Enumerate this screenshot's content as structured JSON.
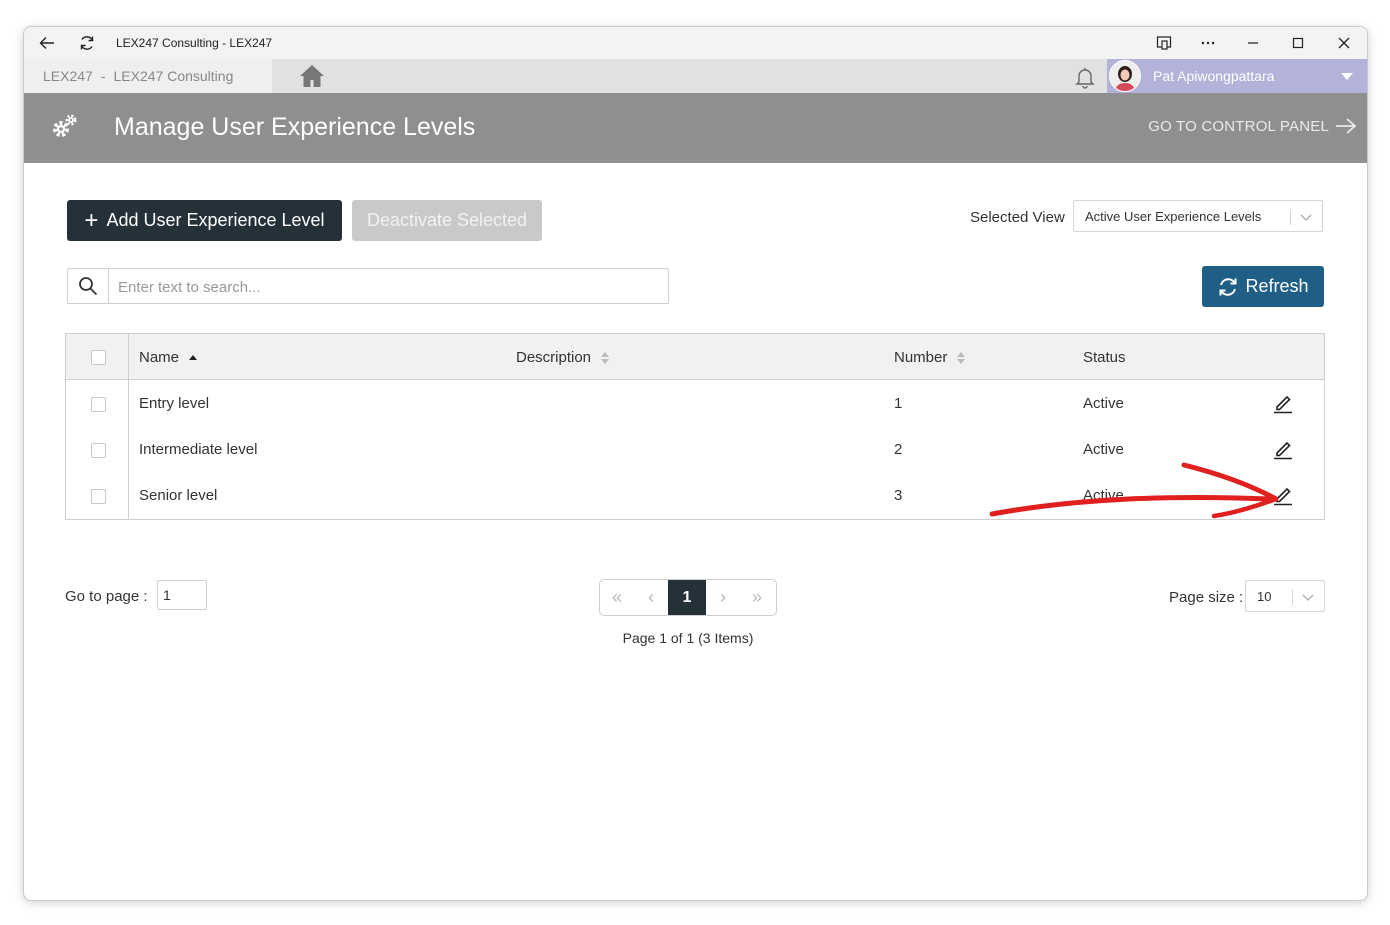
{
  "window": {
    "title": "LEX247 Consulting - LEX247"
  },
  "nav": {
    "org_short": "LEX247",
    "separator": "-",
    "org_name": "LEX247 Consulting",
    "user_name": "Pat Apiwongpattara"
  },
  "header": {
    "title": "Manage User Experience Levels",
    "control_panel_link": "GO TO CONTROL PANEL"
  },
  "toolbar": {
    "add_label": "Add User Experience Level",
    "deactivate_label": "Deactivate Selected",
    "selected_view_label": "Selected View",
    "selected_view_value": "Active User Experience Levels",
    "refresh_label": "Refresh"
  },
  "search": {
    "placeholder": "Enter text to search..."
  },
  "table": {
    "columns": {
      "name": "Name",
      "description": "Description",
      "number": "Number",
      "status": "Status"
    },
    "rows": [
      {
        "name": "Entry level",
        "description": "",
        "number": "1",
        "status": "Active"
      },
      {
        "name": "Intermediate level",
        "description": "",
        "number": "2",
        "status": "Active"
      },
      {
        "name": "Senior level",
        "description": "",
        "number": "3",
        "status": "Active"
      }
    ]
  },
  "pagination": {
    "goto_label": "Go to page :",
    "goto_value": "1",
    "current_page": "1",
    "info": "Page 1 of 1 (3 Items)",
    "page_size_label": "Page size :",
    "page_size_value": "10"
  },
  "colors": {
    "header_bg": "#8f8f8f",
    "primary_dark": "#253138",
    "refresh_blue": "#1f5f86",
    "user_bar": "#b3b3d9",
    "annotation_red": "#e0201e"
  }
}
